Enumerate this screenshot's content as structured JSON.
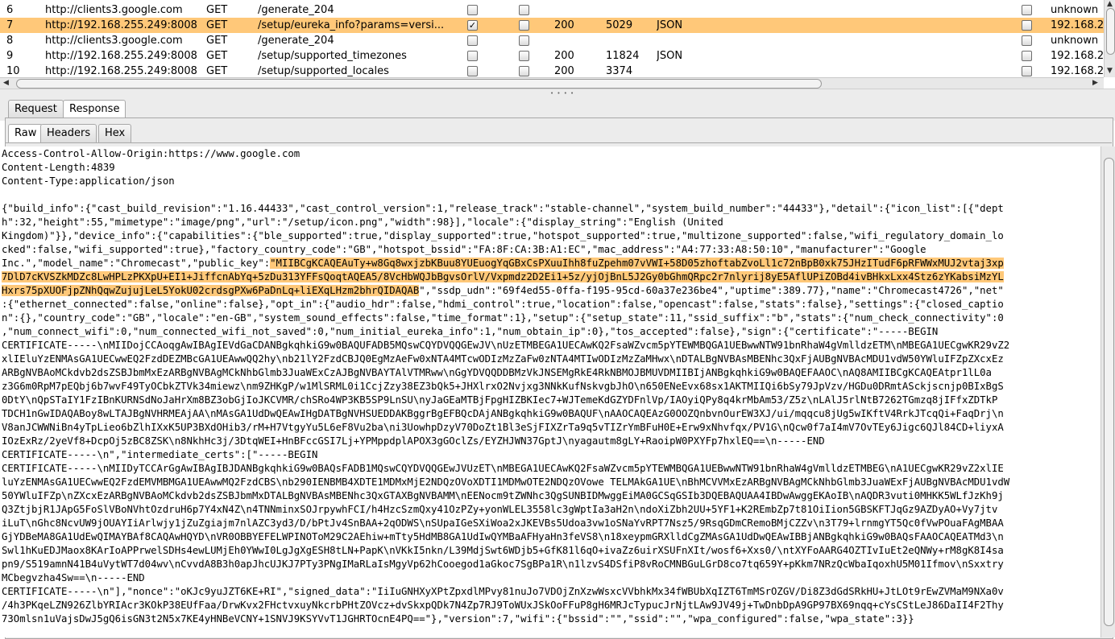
{
  "table": {
    "rows": [
      {
        "num": "6",
        "host": "http://clients3.google.com",
        "method": "GET",
        "url": "/generate_204",
        "checked": false,
        "status": "",
        "length": "",
        "mime": "",
        "ip": "unknown"
      },
      {
        "num": "7",
        "host": "http://192.168.255.249:8008",
        "method": "GET",
        "url": "/setup/eureka_info?params=versi...",
        "checked": true,
        "status": "200",
        "length": "5029",
        "mime": "JSON",
        "ip": "192.168.2"
      },
      {
        "num": "8",
        "host": "http://clients3.google.com",
        "method": "GET",
        "url": "/generate_204",
        "checked": false,
        "status": "",
        "length": "",
        "mime": "",
        "ip": "unknown"
      },
      {
        "num": "9",
        "host": "http://192.168.255.249:8008",
        "method": "GET",
        "url": "/setup/supported_timezones",
        "checked": false,
        "status": "200",
        "length": "11824",
        "mime": "JSON",
        "ip": "192.168.2"
      },
      {
        "num": "10",
        "host": "http://192.168.255.249:8008",
        "method": "GET",
        "url": "/setup/supported_locales",
        "checked": false,
        "status": "200",
        "length": "3374",
        "mime": "",
        "ip": "192.168.2"
      }
    ],
    "selected_row": "7"
  },
  "tabs": {
    "request": "Request",
    "response": "Response"
  },
  "subtabs": {
    "raw": "Raw",
    "headers": "Headers",
    "hex": "Hex"
  },
  "response": {
    "lines": [
      {
        "pre": "Access-Control-Allow-Origin:https://www.google.com",
        "hl": "",
        "post": ""
      },
      {
        "pre": "Content-Length:4839",
        "hl": "",
        "post": ""
      },
      {
        "pre": "Content-Type:application/json",
        "hl": "",
        "post": ""
      },
      {
        "pre": "",
        "hl": "",
        "post": ""
      },
      {
        "pre": "{\"build_info\":{\"cast_build_revision\":\"1.16.44433\",\"cast_control_version\":1,\"release_track\":\"stable-channel\",\"system_build_number\":\"44433\"},\"detail\":{\"icon_list\":[{\"dept",
        "hl": "",
        "post": ""
      },
      {
        "pre": "h\":32,\"height\":55,\"mimetype\":\"image/png\",\"url\":\"/setup/icon.png\",\"width\":98}],\"locale\":{\"display_string\":\"English (United",
        "hl": "",
        "post": ""
      },
      {
        "pre": "Kingdom)\"}},\"device_info\":{\"capabilities\":{\"ble_supported\":true,\"display_supported\":true,\"hotspot_supported\":true,\"multizone_supported\":false,\"wifi_regulatory_domain_lo",
        "hl": "",
        "post": ""
      },
      {
        "pre": "cked\":false,\"wifi_supported\":true},\"factory_country_code\":\"GB\",\"hotspot_bssid\":\"FA:8F:CA:3B:A1:EC\",\"mac_address\":\"A4:77:33:A8:50:10\",\"manufacturer\":\"Google",
        "hl": "",
        "post": ""
      },
      {
        "pre": "Inc.\",\"model_name\":\"Chromecast\",\"public_key\":",
        "hl": "\"MIIBCgKCAQEAuTy+w8Gq8wxjzbKBuu8YUEuogYqGBxCsPXuuIhh8fuZpehm07vVWI+58D05zhoftabZvoLl1c72nBpB0xk75JHzITudF6pRFWWxMUJ2vtaj3xp",
        "post": ""
      },
      {
        "pre": "",
        "hl": "7DlD7cKVSZkMDZc8LwHPLzPKXpU+EI1+JiffcnAbYq+5zDu313YFFsQoqtAQEA5/8VcHbWQJbBgvsOrlV/Vxpmdz2D2Ei1+5z/yjOjBnL5J2Gy0bGhmQRpc2r7nlyrij8yE5AflUPiZOBd4ivBHkxLxx4Stz6zYKabsiMzYL",
        "post": ""
      },
      {
        "pre": "",
        "hl": "Hxrs75pXUOFjpZNhQqwZujujLeL5YokU02crdsgPXw6PaDnLq+liEXqLHzm2bhrQIDAQAB",
        "post": "\",\"ssdp_udn\":\"69f4ed55-0ffa-f195-95cd-60a37e236be4\",\"uptime\":389.77},\"name\":\"Chromecast4726\",\"net\""
      },
      {
        "pre": ":{\"ethernet_connected\":false,\"online\":false},\"opt_in\":{\"audio_hdr\":false,\"hdmi_control\":true,\"location\":false,\"opencast\":false,\"stats\":false},\"settings\":{\"closed_captio",
        "hl": "",
        "post": ""
      },
      {
        "pre": "n\":{},\"country_code\":\"GB\",\"locale\":\"en-GB\",\"system_sound_effects\":false,\"time_format\":1},\"setup\":{\"setup_state\":11,\"ssid_suffix\":\"b\",\"stats\":{\"num_check_connectivity\":0",
        "hl": "",
        "post": ""
      },
      {
        "pre": ",\"num_connect_wifi\":0,\"num_connected_wifi_not_saved\":0,\"num_initial_eureka_info\":1,\"num_obtain_ip\":0},\"tos_accepted\":false},\"sign\":{\"certificate\":\"-----BEGIN",
        "hl": "",
        "post": ""
      },
      {
        "pre": "CERTIFICATE-----\\nMIIDojCCAoqgAwIBAgIEVdGaCDANBgkqhkiG9w0BAQUFADB5MQswCQYDVQQGEwJV\\nUzETMBEGA1UECAwKQ2FsaWZvcm5pYTEWMBQGA1UEBwwNTW91bnRhaW4gVmlldzETM\\nMBEGA1UECgwKR29vZ2",
        "hl": "",
        "post": ""
      },
      {
        "pre": "xlIEluYzENMAsGA1UECwwEQ2FzdDEZMBcGA1UEAwwQQ2hy\\nb21lY2FzdCBJQ0EgMzAeFw0xNTA4MTcwODIzMzZaFw0zNTA4MTIwODIzMzZaMHwx\\nDTALBgNVBAsMBENhc3QxFjAUBgNVBAcMDU1vdW50YWluIFZpZXcxEz",
        "hl": "",
        "post": ""
      },
      {
        "pre": "ARBgNVBAoMCkdvb2dsZSBJbmMxEzARBgNVBAgMCkNhbGlmb3JuaWExCzAJBgNVBAYTAlVTMRww\\nGgYDVQQDDBMzVkJNSEMgRkE4RkNBMOJBMUVDMIIBIjANBgkqhkiG9w0BAQEFAAOC\\nAQ8AMIIBCgKCAQEAtpr1lL0a",
        "hl": "",
        "post": ""
      },
      {
        "pre": "z3G6m0RpM7pEQbj6b7wvF49TyOCbkZTVk34miewz\\nm9ZHKgP/w1MlSRML0i1CcjZzy38EZ3bQk5+JHXlrxO2Nvjxg3NNkKufNskvgbJhO\\n650ENeEvx68sx1AKTMIIQi6bSy79JpVzv/HGDu0DRmtASckjscnjp0BIxBgS",
        "hl": "",
        "post": ""
      },
      {
        "pre": "0DtY\\nQpSTaIY1FzIBnKURNSdNoJaHrXm8BZ3obGjIoJKCVMR/chSRo4WP3KB5SP9LnSU\\nyJaGEaMTBjFpgHIZBKIec7+WJTemeKdGZYDFnlVp/IAOyiQPy8q4krMbAm53/Z5z\\nLAlJ5rlNtB7262TGmzq8jIFfxZDTkP",
        "hl": "",
        "post": ""
      },
      {
        "pre": "TDCH1nGwIDAQABoy8wLTAJBgNVHRMEAjAA\\nMAsGA1UdDwQEAwIHgDATBgNVHSUEDDAKBggrBgEFBQcDAjANBgkqhkiG9w0BAQUF\\nAAOCAQEAzG0OOZQnbvnOurEW3XJ/ui/mqqcu8jUg5wIKftV4RrkJTcqQi+FaqDrj\\n",
        "hl": "",
        "post": ""
      },
      {
        "pre": "V8anJCWWNiBn4yTpLieo6bZlhIXxK5UP3BXdOHib3/rM+H7VtgyYu5L6eF8Vu2ba\\ni3UowhpDzyV70DoZt1Bl3eSjFIXZrTa9q5vTIZrYmBFuH0E+Erw9xNhvfqx/PV1G\\nQcw0f7aI4mV7OvTEy6Jigc6QJl84CD+liyxA",
        "hl": "",
        "post": ""
      },
      {
        "pre": "IOzExRz/2yeVf8+DcpOj5zBC8ZSK\\n8NkhHc3j/3DtqWEI+HnBFccGSI7Lj+YPMppdplAPOX3gGOclZs/EYZHJWN37GptJ\\nyagautm8gLY+RaoipW0PXYFp7hxlEQ==\\n-----END",
        "hl": "",
        "post": ""
      },
      {
        "pre": "CERTIFICATE-----\\n\",\"intermediate_certs\":[\"-----BEGIN",
        "hl": "",
        "post": ""
      },
      {
        "pre": "CERTIFICATE-----\\nMIIDyTCCArGgAwIBAgIBJDANBgkqhkiG9w0BAQsFADB1MQswCQYDVQQGEwJVUzET\\nMBEGA1UECAwKQ2FsaWZvcm5pYTEWMBQGA1UEBwwNTW91bnRhaW4gVmlldzETMBEG\\nA1UECgwKR29vZ2xlIE",
        "hl": "",
        "post": ""
      },
      {
        "pre": "luYzENMAsGA1UECwwEQ2FzdEMVMBMGA1UEAwwMQ2FzdCBS\\nb290IENBMB4XDTE1MDMxMjE2NDQzOVoXDTI1MDMwOTE2NDQzOVowe TELMAkGA1UE\\nBhMCVVMxEzARBgNVBAgMCkNhbGlmb3JuaWExFjAUBgNVBAcMDU1vdW",
        "hl": "",
        "post": ""
      },
      {
        "pre": "50YWluIFZp\\nZXcxEzARBgNVBAoMCkdvb2dsZSBJbmMxDTALBgNVBAsMBENhc3QxGTAXBgNVBAMM\\nEENocm9tZWNhc3QgSUNBIDMwggEiMA0GCSqGSIb3DQEBAQUAA4IBDwAwggEKAoIB\\nAQDR3vuti0MHKK5WLfJzKh9j",
        "hl": "",
        "post": ""
      },
      {
        "pre": "Q3ZtjbjR1JApG5FoSlVBoNVhtOzdruH6p7Y4xN4Z\\n4TNNminxSOJrpywhFCI/h4HzcSzmQxy41OzPZy+yonWLEL3558lc3gWptIa3aH2n\\ndoXiZbh2UU+5YF1+K2REmbZp7t81OiIion5GBSKFTJqGz9AZDyAO+Vy7jtv",
        "hl": "",
        "post": ""
      },
      {
        "pre": "iLuT\\nGhc8NcvUW9jOUAYIiArlwjy1jZuZgiajm7nlAZC3yd3/D/bPtJv4SnBAA+2qODWS\\nSUpaIGeSXiWoa2xJKEVBs5Udoa3vw1oSNaYvRPT7Nsz5/9RsqGDmCRemoBMjCZZv\\n3T79+lrnmgYT5Qc0fVwPOuaFAgMBAA",
        "hl": "",
        "post": ""
      },
      {
        "pre": "GjYDBeMA8GA1UdEwQIMAYBAf8CAQAwHQYD\\nVR0OBBYEFELWPINOToM29C2AEhiw+mTty5HdMB8GA1UdIwQYMBaAFHyaHn3feVS8\\n18xeypmGRXlldCgZMAsGA1UdDwQEAwIBBjANBgkqhkiG9w0BAQsFAAOCAQEATMd3\\n",
        "hl": "",
        "post": ""
      },
      {
        "pre": "Swl1hKuEDJMaox8KArIoAPPrwelSDHs4ewLUMjEh0YWwI0LgJgXgESH8tLN+PapK\\nVKkI5nkn/L39MdjSwt6WDjb5+GfK81l6qO+ivaZz6uirXSUFnXIt/wosf6+Xxs0/\\ntXYFoAARG4OZTIvIuEt2eQNWy+rM8gK8I4sa",
        "hl": "",
        "post": ""
      },
      {
        "pre": "pn9/S519amnN41B4uVytWT7d04wv\\nCvvdA8B3h0apJhcUJKJ7PTy3PNgIMaRLaIsMgyVp62hCooegod1aGkoc7SgBPa1R\\n1lzvS4DSfiP8vRoCMNBGuLGrD8co7tq659Y+pKkm7NRzQcWbaIqoxhU5M01Ifmov\\nSxxtry",
        "hl": "",
        "post": ""
      },
      {
        "pre": "MCbegvzha4Sw==\\n-----END",
        "hl": "",
        "post": ""
      },
      {
        "pre": "CERTIFICATE-----\\n\"],\"nonce\":\"oKJc9yuJZT6KE+RI\",\"signed_data\":\"IiIuGNHXyXPtZpxdlMPvy81nuJo7VDOjZnXzwWsxcVVbhkMx34fWBUbXqIZT6TmMSrOZGV/Di8Z3dGdSRkHU+JtLOt9rEwZVMaM9NXa0v",
        "hl": "",
        "post": ""
      },
      {
        "pre": "/4h3PKqeLZN926ZlbYRIAcr3KOkP38EUfFaa/DrwKvx2FHctvxuyNkcrbPHtZOVcz+dvSkxpQDk7N4Zp7RJ9ToWUxJSkOoFFuP8gH6MRJcTypucJrNjtLAw9JV49j+TwDnbDpA9GP97BX69nqq+cYsCStLeJ86DaII4F2Thy",
        "hl": "",
        "post": ""
      },
      {
        "pre": "73Omlsn1uVajsDwJ5gQ6isGN3t2N5x7KE4yHNBeVCNY+1SNVJ9KSYVvT1JGHRTOcnE4PQ==\"},\"version\":7,\"wifi\":{\"bssid\":\"\",\"ssid\":\"\",\"wpa_configured\":false,\"wpa_state\":3}}",
        "hl": "",
        "post": ""
      }
    ]
  }
}
